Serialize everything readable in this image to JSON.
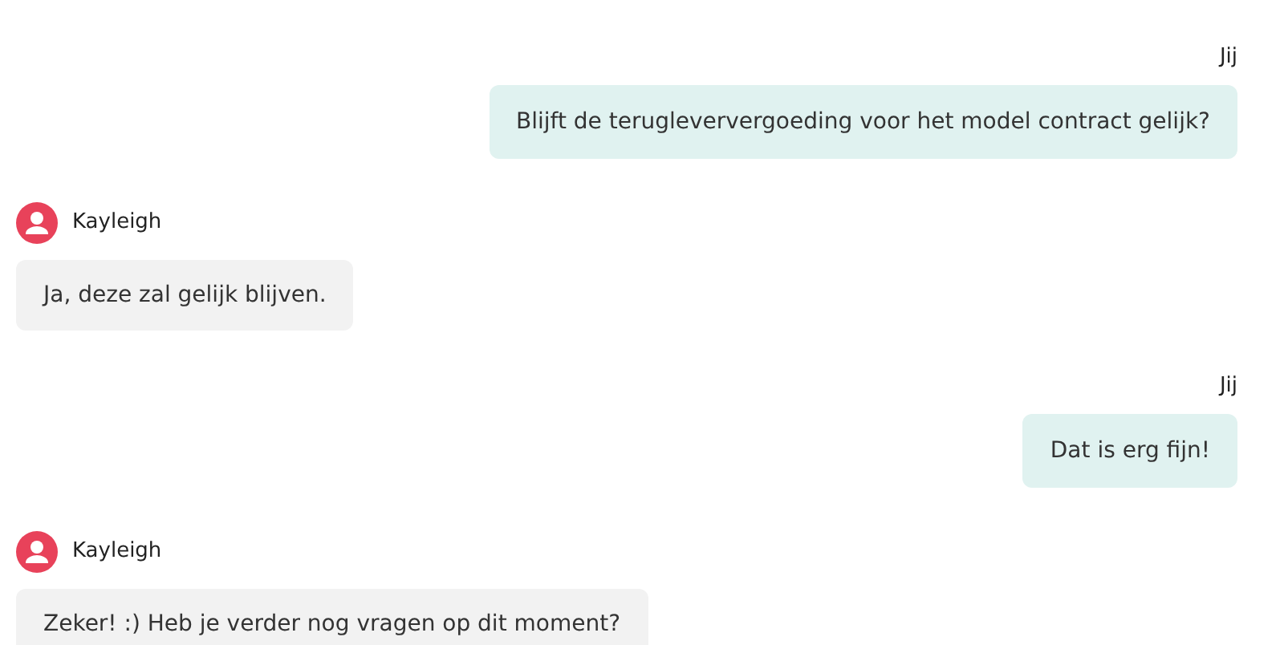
{
  "messages": [
    {
      "kind": "sent",
      "author": "Jij",
      "text": "Blijft de terugleververgoeding voor het model contract gelijk?"
    },
    {
      "kind": "received",
      "author": "Kayleigh",
      "text": "Ja, deze zal gelijk blijven."
    },
    {
      "kind": "sent",
      "author": "Jij",
      "text": "Dat is erg fijn!"
    },
    {
      "kind": "received",
      "author": "Kayleigh",
      "text": "Zeker! :) Heb je verder nog vragen op dit moment?"
    }
  ]
}
